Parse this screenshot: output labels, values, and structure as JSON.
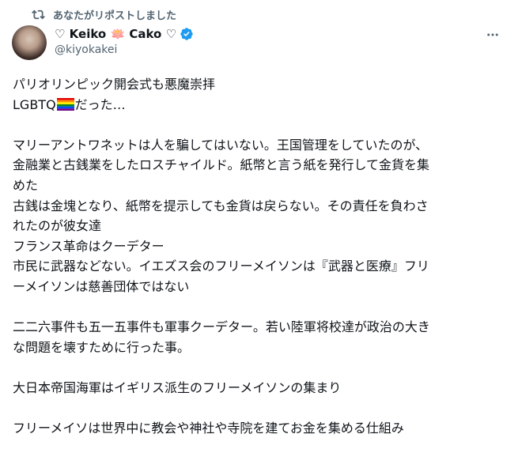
{
  "repost": {
    "label": "あなたがリポストしました",
    "icon": "repost-icon"
  },
  "author": {
    "display_name": "♡ Keiko 🪷 Cako ♡",
    "handle": "@kiyokakei",
    "verified": true,
    "verified_color": "#1d9bf0"
  },
  "more_icon": "more-options-icon",
  "tweet": {
    "line1": "パリオリンピック開会式も悪魔崇拝",
    "line2_prefix": "LGBTQ",
    "line2_suffix": "だった…",
    "p1": "マリーアントワネットは人を騙してはいない。王国管理をしていたのが、",
    "p2": "金融業と古銭業をしたロスチャイルド。紙幣と言う紙を発行して金貨を集",
    "p3": "めた",
    "p4": "古銭は金塊となり、紙幣を提示しても金貨は戻らない。その責任を負わさ",
    "p5": "れたのが彼女達",
    "p6": "フランス革命はクーデター",
    "p7": "市民に武器などない。イエズス会のフリーメイソンは『武器と医療』フリ",
    "p8": "ーメイソンは慈善団体ではない",
    "p9": "二二六事件も五一五事件も軍事クーデター。若い陸軍将校達が政治の大き",
    "p10": "な問題を壊すために行った事。",
    "p11": "大日本帝国海軍はイギリス派生のフリーメイソンの集まり",
    "p12": "フリーメイソは世界中に教会や神社や寺院を建てお金を集める仕組み"
  },
  "colors": {
    "text": "#0f1419",
    "secondary": "#536471",
    "accent": "#1d9bf0"
  }
}
